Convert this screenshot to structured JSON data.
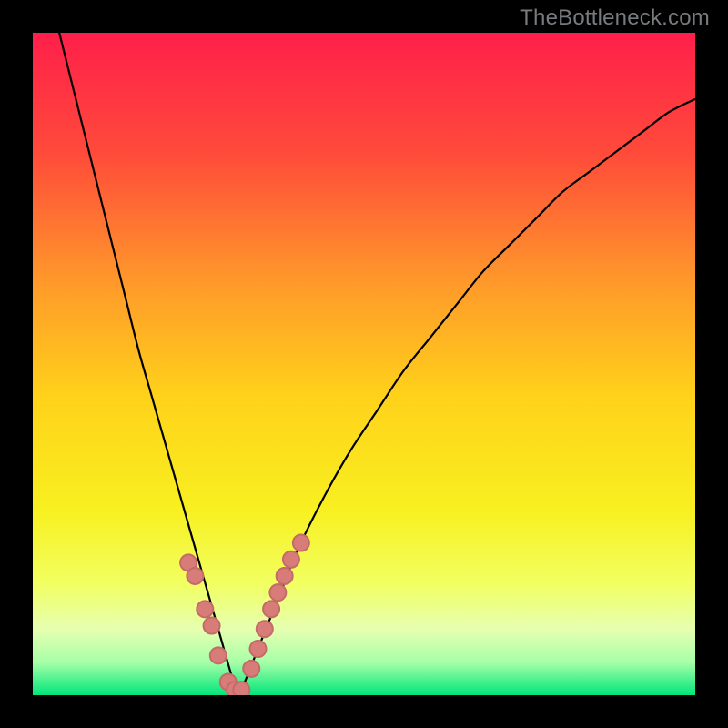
{
  "watermark": {
    "text": "TheBottleneck.com"
  },
  "colors": {
    "frame": "#000000",
    "curve": "#000000",
    "marker_fill": "#d77c78",
    "marker_stroke": "#c46b67",
    "gradient_stops": [
      {
        "offset": 0.0,
        "color": "#ff1f4a"
      },
      {
        "offset": 0.18,
        "color": "#ff4a3a"
      },
      {
        "offset": 0.38,
        "color": "#ff9a2a"
      },
      {
        "offset": 0.55,
        "color": "#ffd21a"
      },
      {
        "offset": 0.72,
        "color": "#f8f020"
      },
      {
        "offset": 0.83,
        "color": "#f2ff60"
      },
      {
        "offset": 0.9,
        "color": "#e6ffb0"
      },
      {
        "offset": 0.95,
        "color": "#a8ffa8"
      },
      {
        "offset": 1.0,
        "color": "#00e67a"
      }
    ]
  },
  "chart_data": {
    "type": "line",
    "title": "",
    "xlabel": "",
    "ylabel": "",
    "xlim": [
      0,
      100
    ],
    "ylim": [
      0,
      100
    ],
    "min_x": 31,
    "series": [
      {
        "name": "bottleneck-curve",
        "x": [
          4,
          6,
          8,
          10,
          12,
          14,
          16,
          18,
          20,
          22,
          24,
          26,
          28,
          30,
          31,
          32,
          34,
          36,
          38,
          40,
          44,
          48,
          52,
          56,
          60,
          64,
          68,
          72,
          76,
          80,
          84,
          88,
          92,
          96,
          100
        ],
        "values": [
          100,
          92,
          84,
          76,
          68,
          60,
          52,
          45,
          38,
          31,
          24,
          17,
          10,
          3,
          0,
          2,
          7,
          12,
          17,
          22,
          30,
          37,
          43,
          49,
          54,
          59,
          64,
          68,
          72,
          76,
          79,
          82,
          85,
          88,
          90
        ]
      }
    ],
    "markers": {
      "name": "highlighted-points",
      "x": [
        23.5,
        24.5,
        26.0,
        27.0,
        28.0,
        29.5,
        30.5,
        31.5,
        33.0,
        34.0,
        35.0,
        36.0,
        37.0,
        38.0,
        39.0,
        40.5
      ],
      "values": [
        20.0,
        18.0,
        13.0,
        10.5,
        6.0,
        2.0,
        0.8,
        0.8,
        4.0,
        7.0,
        10.0,
        13.0,
        15.5,
        18.0,
        20.5,
        23.0
      ]
    }
  }
}
